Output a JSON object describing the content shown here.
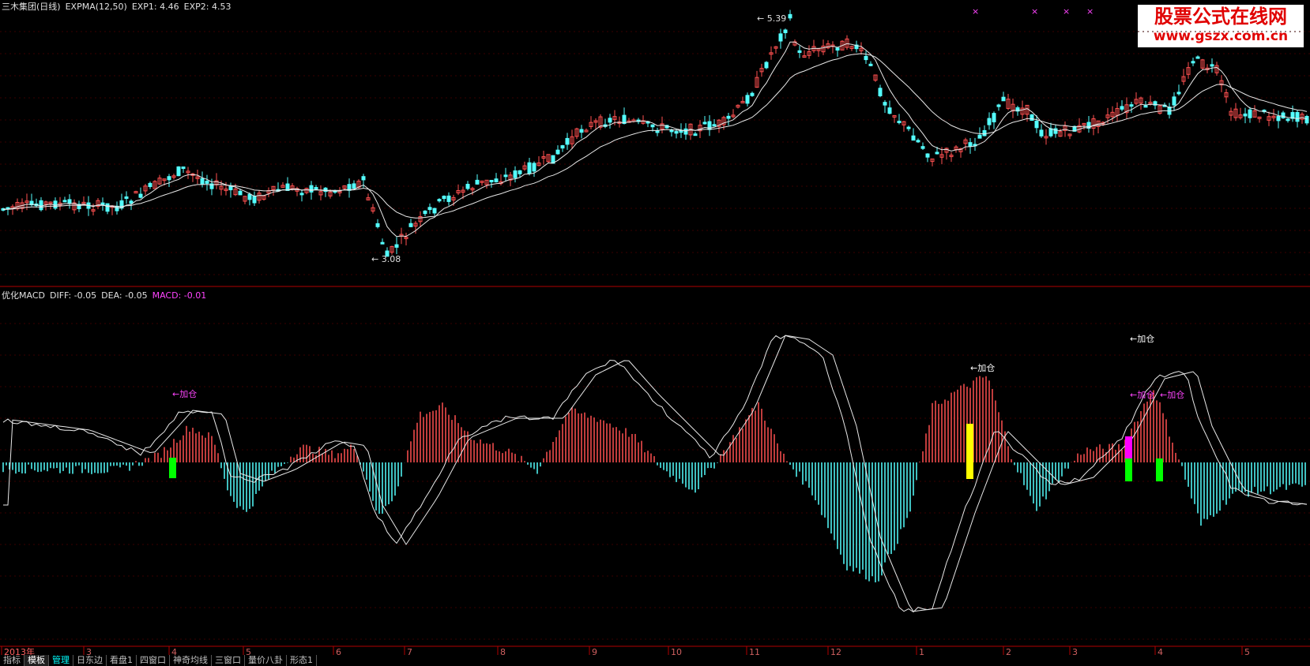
{
  "price_panel": {
    "title": "三木集团(日线)",
    "indicator": "EXPMA(12,50)",
    "exp1_label": "EXP1: 4.46",
    "exp2_label": "EXP2: 4.53",
    "high_label": "5.39",
    "low_label": "3.08"
  },
  "macd_panel": {
    "name": "优化MACD",
    "diff_label": "DIFF: -0.05",
    "dea_label": "DEA: -0.05",
    "macd_label": "MACD: -0.01",
    "annotation_text": "←加仓"
  },
  "watermark": {
    "line1": "股票公式在线网",
    "line2": "www.gszx.com.cn"
  },
  "time_axis": {
    "labels": [
      "2013年",
      "3",
      "4",
      "5",
      "6",
      "7",
      "8",
      "9",
      "10",
      "11",
      "12",
      "1",
      "2",
      "3",
      "4",
      "5"
    ]
  },
  "tabs": [
    "指标",
    "模板",
    "管理",
    "日东边",
    "看盘1",
    "四窗口",
    "神奇均线",
    "三窗口",
    "量价八卦",
    "形态1"
  ],
  "colors": {
    "up": "#ff5050",
    "down": "#54ffff",
    "ma": "#e8e8e8",
    "grid": "#3a0000",
    "axis": "#b00000",
    "macd_label": "#ff44ff",
    "pink_annotation": "#ff44ff",
    "white_annotation": "#ffffff",
    "marker_green": "#00ff00",
    "marker_yellow": "#ffff00",
    "marker_magenta": "#ff00ff"
  },
  "chart_data": {
    "type": "line",
    "price_range": [
      3.08,
      5.39
    ],
    "macd_annotations": [
      {
        "text": "←加仓",
        "color": "pink"
      },
      {
        "text": "←加仓",
        "color": "white"
      },
      {
        "text": "←加仓",
        "color": "white"
      },
      {
        "text": "←加仓",
        "color": "pink"
      },
      {
        "text": "←加仓",
        "color": "pink"
      }
    ]
  }
}
